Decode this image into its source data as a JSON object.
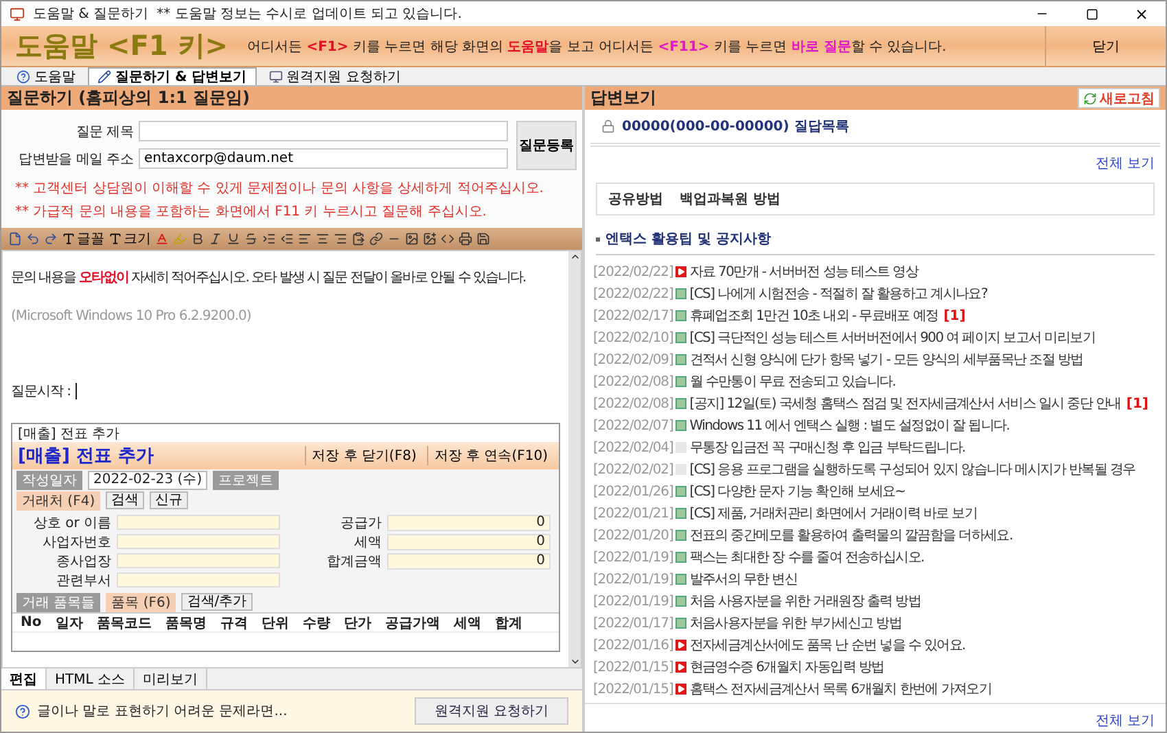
{
  "window": {
    "title": "도움말 & 질문하기",
    "notice": "** 도움말 정보는 수시로 업데이트 되고 있습니다."
  },
  "header": {
    "title": "도움말 <F1 키>",
    "message": [
      {
        "text": "어디서든 ",
        "kind": "plain"
      },
      {
        "text": "<F1>",
        "kind": "accent"
      },
      {
        "text": " 키를 누르면 해당 화면의 ",
        "kind": "plain"
      },
      {
        "text": "도움말",
        "kind": "accent"
      },
      {
        "text": "을 보고 어디서든 ",
        "kind": "plain"
      },
      {
        "text": "<F11>",
        "kind": "strong"
      },
      {
        "text": " 키를 누르면 ",
        "kind": "plain"
      },
      {
        "text": "바로 질문",
        "kind": "strong"
      },
      {
        "text": "할 수 있습니다.",
        "kind": "plain"
      }
    ],
    "close_button": "닫기"
  },
  "tabs": [
    {
      "label": "도움말",
      "selected": false
    },
    {
      "label": "질문하기 & 답변보기",
      "selected": true
    },
    {
      "label": "원격지원 요청하기",
      "selected": false
    }
  ],
  "question": {
    "title": "질문하기 (홈피상의 1:1 질문임)",
    "fields": [
      {
        "label": "질문 제목"
      },
      {
        "label": "답변받을 메일 주소",
        "value": "entaxcorp@daum.net"
      }
    ],
    "submit": "질문등록",
    "notes": [
      "** 고객센터 상담원이 이해할 수 있게 문제점이나 문의 사항을 상세하게 적어주십시오.",
      "** 가급적 문의 내용을 포함하는 화면에서 F11 키 누르시고 질문해 주십시오."
    ],
    "toolbar": {
      "font": "글꼴",
      "size": "크기"
    },
    "editor_lines": [
      {
        "kind": "text",
        "segments": [
          {
            "text": "문의 내용을 ",
            "kind": "plain"
          },
          {
            "text": "오타없이",
            "kind": "accent"
          },
          {
            "text": " 자세히 적어주십시오. 오타 발생 시 질문 전달이 올바로 안될 수 있습니다.",
            "kind": "plain"
          }
        ]
      },
      {
        "kind": "system",
        "segments": [
          {
            "text": "(Microsoft Windows 10 Pro 6.2.9200.0)",
            "kind": "plain"
          }
        ]
      },
      {
        "kind": "prompt",
        "segments": [
          {
            "text": "질문시작 :",
            "kind": "plain"
          }
        ]
      }
    ],
    "embedded_screenshot": {
      "window_title": "[매출] 전표 추가",
      "heading": "[매출] 전표 추가",
      "buttons": [
        "저장 후 닫기(F8)",
        "저장 후 연속(F10)"
      ],
      "date_label": "작성일자",
      "date": "2022-02-23 (수)",
      "project_label": "프로젝트",
      "client_label": "거래처 (F4)",
      "client_buttons": [
        "검색",
        "신규"
      ],
      "left_fields": [
        "상호 or 이름",
        "사업자번호",
        "종사업장",
        "관련부서"
      ],
      "amounts": [
        {
          "label": "공급가",
          "value": "0"
        },
        {
          "label": "세액",
          "value": "0"
        },
        {
          "label": "합계금액",
          "value": "0"
        }
      ],
      "items_label": "거래 품목들",
      "item_label": "품목 (F6)",
      "item_button": "검색/추가",
      "columns": [
        "No",
        "일자",
        "품목코드",
        "품목명",
        "규격",
        "단위",
        "수량",
        "단가",
        "공급가액",
        "세액",
        "합계"
      ]
    },
    "editor_tabs": [
      {
        "label": "편집",
        "selected": true
      },
      {
        "label": "HTML 소스",
        "selected": false
      },
      {
        "label": "미리보기",
        "selected": false
      }
    ],
    "footer": {
      "text": "글이나 말로 표현하기 어려운 문제라면...",
      "button": "원격지원 요청하기"
    }
  },
  "answers": {
    "title": "답변보기",
    "refresh": "새로고침",
    "list_title": "00000(000-00-00000) 질답목록",
    "view_all": "전체 보기",
    "links": [
      "공유방법",
      "백업과복원 방법"
    ],
    "notice_title": "엔택스 활용팁 및 공지사항",
    "items": [
      {
        "date": "[2022/02/22]",
        "kind": "video",
        "title": "자료 70만개 - 서버버전 성능 테스트 영상"
      },
      {
        "date": "[2022/02/22]",
        "kind": "image",
        "title": "[CS] 나에게 시험전송 - 적절히 잘 활용하고 계시나요?"
      },
      {
        "date": "[2022/02/17]",
        "kind": "image",
        "title": "휴폐업조회 1만건 10초 내외 - 무료배포 예정",
        "badge": "[1]"
      },
      {
        "date": "[2022/02/10]",
        "kind": "image",
        "title": "[CS] 극단적인 성능 테스트 서버버전에서 900 여 페이지 보고서 미리보기"
      },
      {
        "date": "[2022/02/09]",
        "kind": "image",
        "title": "견적서 신형 양식에 단가 항목 넣기 - 모든 양식의 세부품목난 조절 방법"
      },
      {
        "date": "[2022/02/08]",
        "kind": "image",
        "title": "월 수만통이 무료 전송되고 있습니다."
      },
      {
        "date": "[2022/02/08]",
        "kind": "image",
        "title": "[공지] 12일(토) 국세청 홈택스 점검 및 전자세금계산서 서비스 일시 중단 안내",
        "badge": "[1]"
      },
      {
        "date": "[2022/02/07]",
        "kind": "image",
        "title": "Windows 11 에서 엔택스 실행 : 별도 설정없이 잘 됩니다."
      },
      {
        "date": "[2022/02/04]",
        "kind": "faded",
        "title": "무통장 입금전 꼭 구매신청 후 입금 부탁드립니다."
      },
      {
        "date": "[2022/02/02]",
        "kind": "faded",
        "title": "[CS] 응용 프로그램을 실행하도록 구성되어 있지 않습니다 메시지가 반복될 경우"
      },
      {
        "date": "[2022/01/26]",
        "kind": "image",
        "title": "[CS] 다양한 문자 기능 확인해 보세요~"
      },
      {
        "date": "[2022/01/21]",
        "kind": "image",
        "title": "[CS] 제품, 거래처관리 화면에서 거래이력 바로 보기"
      },
      {
        "date": "[2022/01/20]",
        "kind": "image",
        "title": "전표의 중간메모를 활용하여 출력물의 깔끔함을 더하세요."
      },
      {
        "date": "[2022/01/19]",
        "kind": "image",
        "title": "팩스는 최대한 장 수를 줄여 전송하십시오."
      },
      {
        "date": "[2022/01/19]",
        "kind": "image",
        "title": "발주서의 무한 변신"
      },
      {
        "date": "[2022/01/19]",
        "kind": "image",
        "title": "처음 사용자분을 위한 거래원장 출력 방법"
      },
      {
        "date": "[2022/01/17]",
        "kind": "image",
        "title": "처음사용자분을 위한 부가세신고 방법"
      },
      {
        "date": "[2022/01/16]",
        "kind": "video",
        "title": "전자세금계산서에도 품목 난 순번 넣을 수 있어요."
      },
      {
        "date": "[2022/01/15]",
        "kind": "video",
        "title": "현금영수증 6개월치 자동입력 방법"
      },
      {
        "date": "[2022/01/15]",
        "kind": "video",
        "title": "홈택스 전자세금계산서 목록 6개월치 한번에 가져오기"
      }
    ],
    "view_all_bottom": "전체 보기"
  }
}
